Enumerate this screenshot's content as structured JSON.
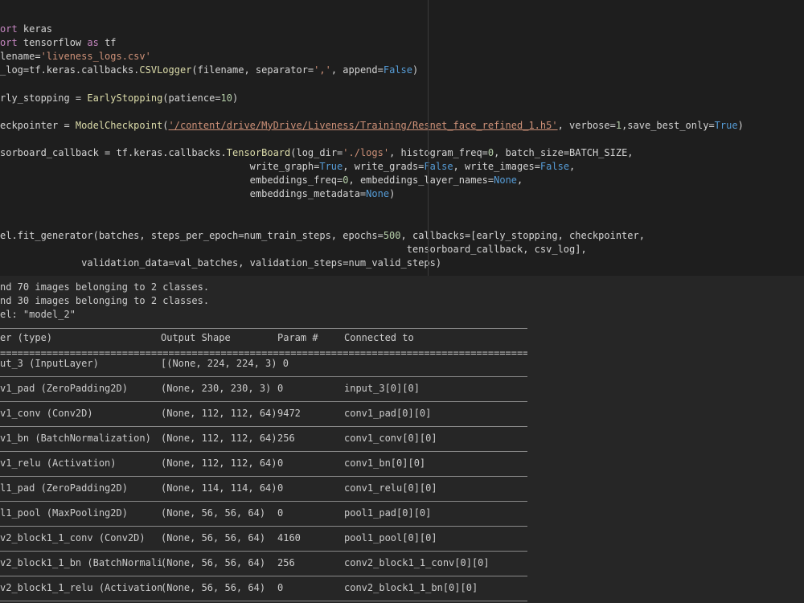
{
  "code_lines": [
    [
      [
        "k",
        "ort"
      ],
      [
        "t",
        " keras"
      ]
    ],
    [
      [
        "k",
        "ort"
      ],
      [
        "t",
        " tensorflow "
      ],
      [
        "k",
        "as"
      ],
      [
        "t",
        " tf"
      ]
    ],
    [
      [
        "t",
        "lename="
      ],
      [
        "s",
        "'liveness_logs.csv'"
      ]
    ],
    [
      [
        "t",
        "_log=tf.keras.callbacks."
      ],
      [
        "f",
        "CSVLogger"
      ],
      [
        "t",
        "(filename, separator="
      ],
      [
        "s",
        "','"
      ],
      [
        "t",
        ", append="
      ],
      [
        "b",
        "False"
      ],
      [
        "t",
        ")"
      ]
    ],
    [],
    [
      [
        "t",
        "rly_stopping = "
      ],
      [
        "f",
        "EarlyStopping"
      ],
      [
        "t",
        "(patience="
      ],
      [
        "n",
        "10"
      ],
      [
        "t",
        ")"
      ]
    ],
    [],
    [
      [
        "t",
        "eckpointer = "
      ],
      [
        "f",
        "ModelCheckpoint"
      ],
      [
        "t",
        "("
      ],
      [
        "su",
        "'/content/drive/MyDrive/Liveness/Training/Resnet_face_refined_1.h5'"
      ],
      [
        "t",
        ", verbose="
      ],
      [
        "n",
        "1"
      ],
      [
        "t",
        ",save_best_only="
      ],
      [
        "b",
        "True"
      ],
      [
        "t",
        ")"
      ]
    ],
    [],
    [
      [
        "t",
        "sorboard_callback = tf.keras.callbacks."
      ],
      [
        "f",
        "TensorBoard"
      ],
      [
        "t",
        "(log_dir="
      ],
      [
        "s",
        "'./logs'"
      ],
      [
        "t",
        ", histogram_freq="
      ],
      [
        "n",
        "0"
      ],
      [
        "t",
        ", batch_size=BATCH_SIZE,"
      ]
    ],
    [
      [
        "t",
        "                                           write_graph="
      ],
      [
        "b",
        "True"
      ],
      [
        "t",
        ", write_grads="
      ],
      [
        "b",
        "False"
      ],
      [
        "t",
        ", write_images="
      ],
      [
        "b",
        "False"
      ],
      [
        "t",
        ","
      ]
    ],
    [
      [
        "t",
        "                                           embeddings_freq="
      ],
      [
        "n",
        "0"
      ],
      [
        "t",
        ", embeddings_layer_names="
      ],
      [
        "b",
        "None"
      ],
      [
        "t",
        ","
      ]
    ],
    [
      [
        "t",
        "                                           embeddings_metadata="
      ],
      [
        "b",
        "None"
      ],
      [
        "t",
        ")"
      ]
    ],
    [],
    [],
    [
      [
        "t",
        "el.fit_generator(batches, steps_per_epoch=num_train_steps, epochs="
      ],
      [
        "n",
        "500"
      ],
      [
        "t",
        ", callbacks=[early_stopping, checkpointer,"
      ]
    ],
    [
      [
        "t",
        "                                                                      tensorboard_callback, csv_log],"
      ]
    ],
    [
      [
        "t",
        "              validation_data=val_batches, validation_steps=num_valid_steps)"
      ]
    ]
  ],
  "output": {
    "messages": [
      "nd 70 images belonging to 2 classes.",
      "nd 30 images belonging to 2 classes.",
      "el: \"model_2\""
    ],
    "headers": [
      "er (type)",
      "Output Shape",
      "Param #",
      "Connected to"
    ],
    "equals_rule": "==========================================================================================================",
    "rows": [
      {
        "layer": "ut_3 (InputLayer)",
        "shape": "[(None, 224, 224, 3) 0",
        "param": "",
        "conn": ""
      },
      {
        "layer": "v1_pad (ZeroPadding2D)",
        "shape": "(None, 230, 230, 3)",
        "param": "0",
        "conn": "input_3[0][0]"
      },
      {
        "layer": "v1_conv (Conv2D)",
        "shape": "(None, 112, 112, 64)",
        "param": "9472",
        "conn": "conv1_pad[0][0]"
      },
      {
        "layer": "v1_bn (BatchNormalization)",
        "shape": "(None, 112, 112, 64)",
        "param": "256",
        "conn": "conv1_conv[0][0]"
      },
      {
        "layer": "v1_relu (Activation)",
        "shape": "(None, 112, 112, 64)",
        "param": "0",
        "conn": "conv1_bn[0][0]"
      },
      {
        "layer": "l1_pad (ZeroPadding2D)",
        "shape": "(None, 114, 114, 64)",
        "param": "0",
        "conn": "conv1_relu[0][0]"
      },
      {
        "layer": "l1_pool (MaxPooling2D)",
        "shape": "(None, 56, 56, 64)",
        "param": "0",
        "conn": "pool1_pad[0][0]"
      },
      {
        "layer": "v2_block1_1_conv (Conv2D)",
        "shape": "(None, 56, 56, 64)",
        "param": "4160",
        "conn": "pool1_pool[0][0]"
      },
      {
        "layer": "v2_block1_1_bn (BatchNormali",
        "shape": "(None, 56, 56, 64)",
        "param": "256",
        "conn": "conv2_block1_1_conv[0][0]"
      },
      {
        "layer": "v2_block1_1_relu (Activation",
        "shape": "(None, 56, 56, 64)",
        "param": "0",
        "conn": "conv2_block1_1_bn[0][0]"
      }
    ]
  },
  "colors": {
    "editor_bg": "#1e1e1e",
    "output_bg": "#262626",
    "keyword": "#c586c0",
    "string": "#ce9178",
    "builtin_constant": "#569cd6",
    "number": "#b5cea8",
    "function": "#dcdcaa"
  }
}
